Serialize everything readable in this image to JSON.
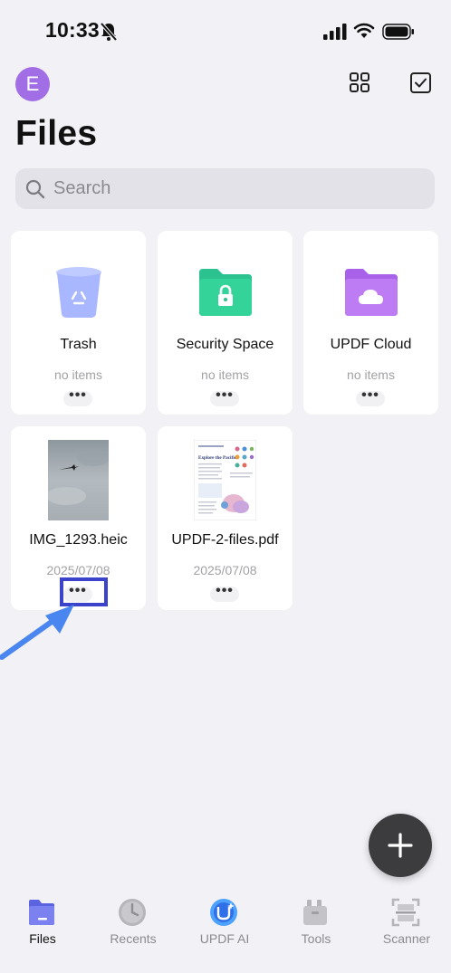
{
  "status_bar": {
    "time": "10:33"
  },
  "header": {
    "avatar_initial": "E",
    "title": "Files"
  },
  "search": {
    "placeholder": "Search"
  },
  "folders": [
    {
      "name": "Trash",
      "meta": "no items",
      "icon": "trash-icon"
    },
    {
      "name": "Security Space",
      "meta": "no items",
      "icon": "security-folder-icon"
    },
    {
      "name": "UPDF Cloud",
      "meta": "no items",
      "icon": "cloud-folder-icon"
    }
  ],
  "files": [
    {
      "name": "IMG_1293.heic",
      "date": "2025/07/08",
      "icon": "image-thumbnail"
    },
    {
      "name": "UPDF-2-files.pdf",
      "date": "2025/07/08",
      "icon": "pdf-thumbnail",
      "thumbnail_text": "Explore the Pacific"
    }
  ],
  "more_label": "•••",
  "tabs": [
    {
      "label": "Files",
      "icon": "files-icon",
      "active": true
    },
    {
      "label": "Recents",
      "icon": "clock-icon",
      "active": false
    },
    {
      "label": "UPDF AI",
      "icon": "updf-ai-icon",
      "active": false
    },
    {
      "label": "Tools",
      "icon": "tools-icon",
      "active": false
    },
    {
      "label": "Scanner",
      "icon": "scanner-icon",
      "active": false
    }
  ],
  "colors": {
    "background": "#f2f1f6",
    "avatar": "#a26ee6",
    "security_folder": "#2bc28f",
    "cloud_folder": "#b56ff0",
    "highlight": "#3a43c9",
    "annotation_arrow": "#4a86f0",
    "fab": "#3c3c3e"
  }
}
